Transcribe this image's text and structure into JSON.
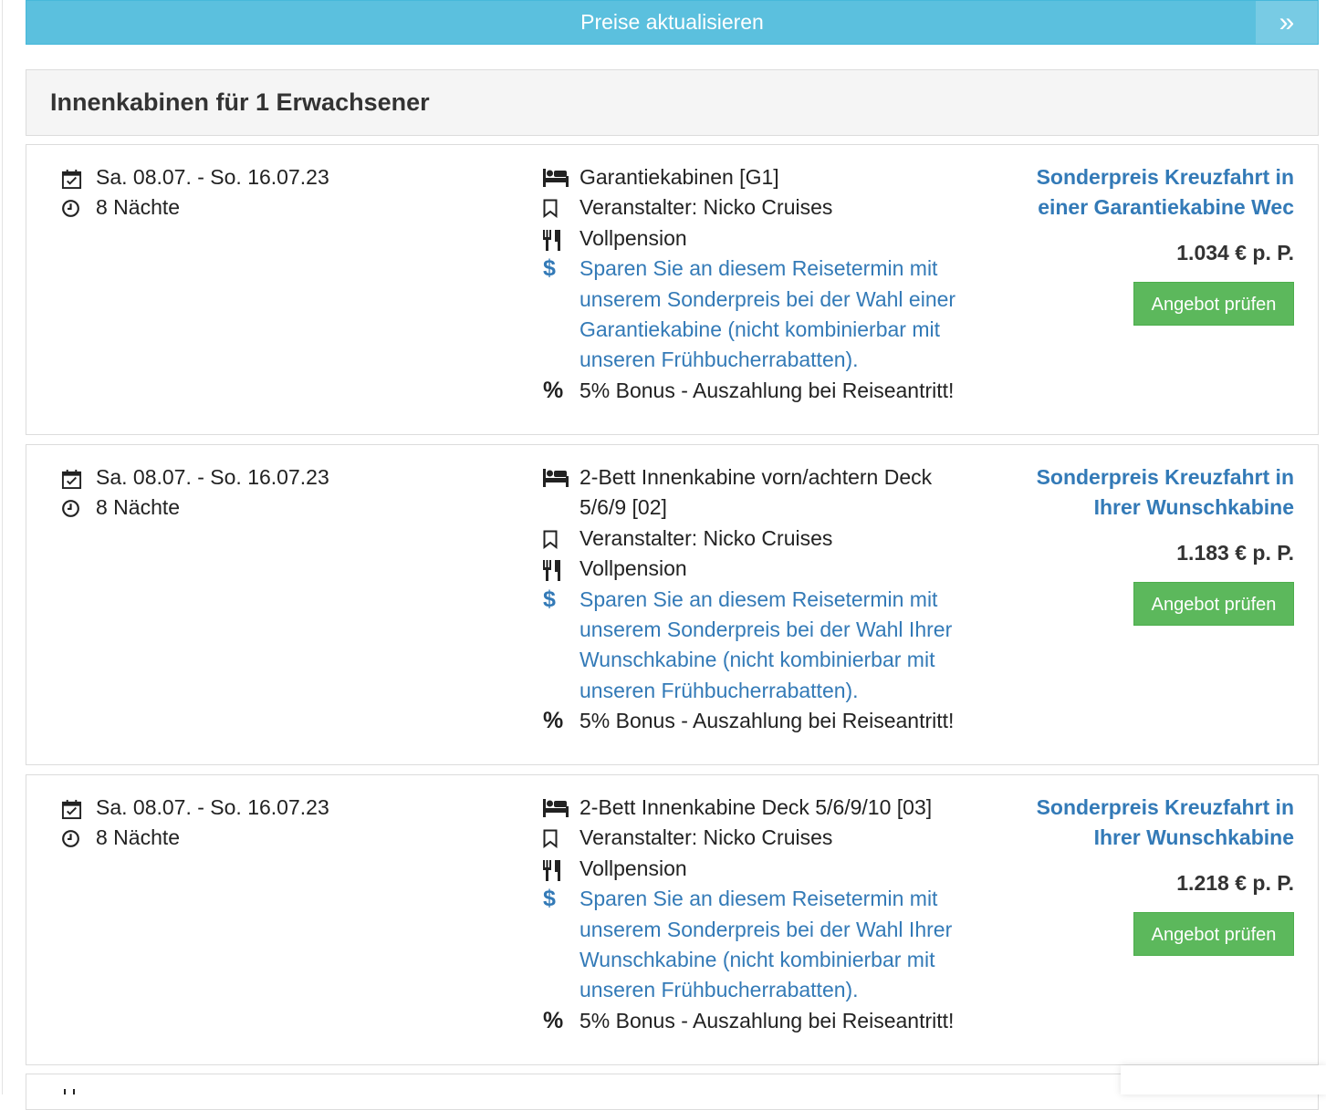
{
  "update_bar": {
    "label": "Preise aktualisieren",
    "icon": "double-chevron-right-icon"
  },
  "section": {
    "title": "Innenkabinen für 1 Erwachsener"
  },
  "offers": [
    {
      "dates": "Sa. 08.07. - So. 16.07.23",
      "nights": "8 Nächte",
      "cabin": "Garantiekabinen [G1]",
      "operator": "Veranstalter: Nicko Cruises",
      "board": "Vollpension",
      "saving": "Sparen Sie an diesem Reisetermin mit unserem Sonderpreis bei der Wahl einer Garantiekabine (nicht kombinierbar mit unseren Frühbucherrabatten).",
      "bonus": "5% Bonus - Auszahlung bei Reiseantritt!",
      "title_line1": "Sonderpreis Kreuzfahrt in",
      "title_line2": "einer Garantiekabine Wec",
      "price": "1.034 € p. P.",
      "button": "Angebot prüfen"
    },
    {
      "dates": "Sa. 08.07. - So. 16.07.23",
      "nights": "8 Nächte",
      "cabin": "2-Bett Innenkabine vorn/achtern Deck 5/6/9 [02]",
      "operator": "Veranstalter: Nicko Cruises",
      "board": "Vollpension",
      "saving": "Sparen Sie an diesem Reisetermin mit unserem Sonderpreis bei der Wahl Ihrer Wunschkabine (nicht kombinierbar mit unseren Frühbucherrabatten).",
      "bonus": "5% Bonus - Auszahlung bei Reiseantritt!",
      "title_line1": "Sonderpreis Kreuzfahrt in",
      "title_line2": "Ihrer Wunschkabine",
      "price": "1.183 € p. P.",
      "button": "Angebot prüfen"
    },
    {
      "dates": "Sa. 08.07. - So. 16.07.23",
      "nights": "8 Nächte",
      "cabin": "2-Bett Innenkabine Deck 5/6/9/10 [03]",
      "operator": "Veranstalter: Nicko Cruises",
      "board": "Vollpension",
      "saving": "Sparen Sie an diesem Reisetermin mit unserem Sonderpreis bei der Wahl Ihrer Wunschkabine (nicht kombinierbar mit unseren Frühbucherrabatten).",
      "bonus": "5% Bonus - Auszahlung bei Reiseantritt!",
      "title_line1": "Sonderpreis Kreuzfahrt in",
      "title_line2": "Ihrer Wunschkabine",
      "price": "1.218 € p. P.",
      "button": "Angebot prüfen"
    }
  ],
  "colors": {
    "info": "#5bc0de",
    "success": "#5cb85c",
    "link": "#337ab7"
  }
}
